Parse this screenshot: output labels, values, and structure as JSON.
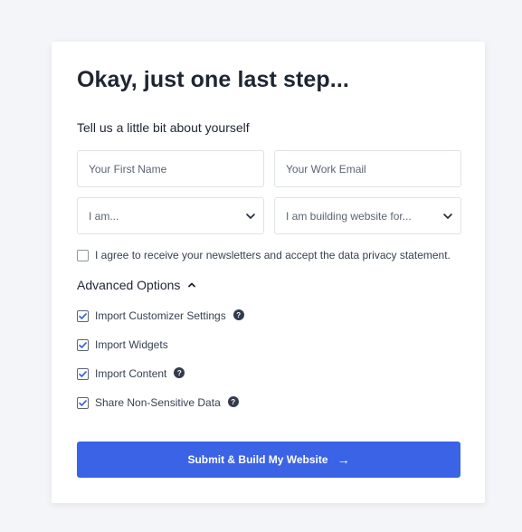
{
  "form": {
    "title": "Okay, just one last step...",
    "subtitle": "Tell us a little bit about yourself",
    "first_name_placeholder": "Your First Name",
    "email_placeholder": "Your Work Email",
    "role_select": {
      "value": "I am...",
      "icon": "chevron-down-icon"
    },
    "purpose_select": {
      "value": "I am building website for...",
      "icon": "chevron-down-icon"
    },
    "newsletter": {
      "label": "I agree to receive your newsletters and accept the data privacy statement.",
      "checked": false
    }
  },
  "advanced": {
    "label": "Advanced Options",
    "expanded": true,
    "icon": "chevron-up-icon",
    "options": [
      {
        "label": "Import Customizer Settings",
        "checked": true,
        "help": true
      },
      {
        "label": "Import Widgets",
        "checked": true,
        "help": false
      },
      {
        "label": "Import Content",
        "checked": true,
        "help": true
      },
      {
        "label": "Share Non-Sensitive Data",
        "checked": true,
        "help": true
      }
    ],
    "help_glyph": "?"
  },
  "submit": {
    "label": "Submit & Build My Website",
    "arrow": "→"
  },
  "colors": {
    "accent": "#3b63e5",
    "background": "#f4f5f8",
    "heading": "#1e2532"
  }
}
